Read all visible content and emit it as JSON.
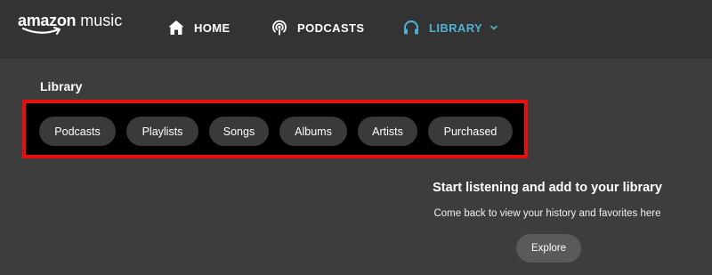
{
  "brand": {
    "word1": "amazon",
    "word2": "music"
  },
  "nav": {
    "home_label": "HOME",
    "podcasts_label": "PODCASTS",
    "library_label": "LIBRARY",
    "active_color": "#4fb0d3",
    "icons": [
      "home-icon",
      "podcast-icon",
      "headphones-icon",
      "chevron-down-icon"
    ]
  },
  "library": {
    "title": "Library",
    "chips": [
      "Podcasts",
      "Playlists",
      "Songs",
      "Albums",
      "Artists",
      "Purchased"
    ],
    "highlight_color": "#e80e0e"
  },
  "empty_state": {
    "title": "Start listening and add to your library",
    "subtitle": "Come back to view your history and favorites here",
    "button_label": "Explore"
  }
}
